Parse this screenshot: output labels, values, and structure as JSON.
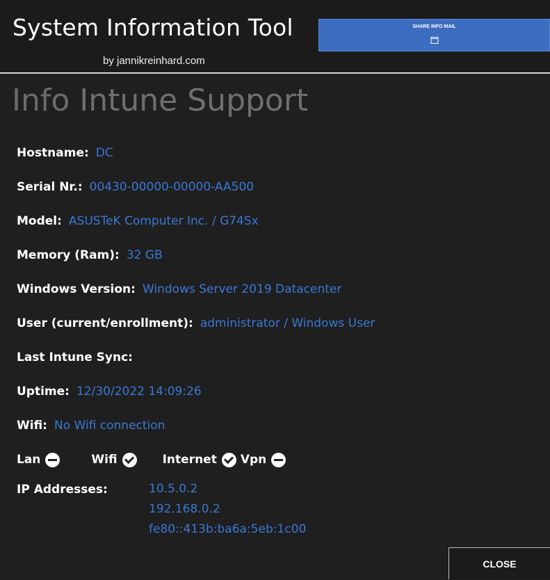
{
  "header": {
    "title": "System Information Tool",
    "byline": "by jannikreinhard.com",
    "button_label": "SHARE INFO MAIL"
  },
  "nav": {
    "tabs": [
      {
        "label": "Info"
      },
      {
        "label": "Intune"
      },
      {
        "label": "Support"
      }
    ]
  },
  "info": {
    "hostname": {
      "label": "Hostname:",
      "value": "DC"
    },
    "serial": {
      "label": "Serial Nr.:",
      "value": "00430-00000-00000-AA500"
    },
    "model": {
      "label": "Model:",
      "value": "ASUSTeK Computer Inc. / G74Sx"
    },
    "memory": {
      "label": "Memory (Ram):",
      "value": "32 GB"
    },
    "windows_version": {
      "label": "Windows Version:",
      "value": "Windows Server 2019 Datacenter"
    },
    "user": {
      "label": "User (current/enrollment):",
      "value": "administrator / Windows User"
    },
    "last_sync": {
      "label": "Last Intune Sync:",
      "value": ""
    },
    "uptime": {
      "label": "Uptime:",
      "value": "12/30/2022 14:09:26"
    },
    "wifi": {
      "label": "Wifi:",
      "value": "No Wifi connection"
    }
  },
  "status": {
    "lan": {
      "label": "Lan",
      "icon": "minus-circle-icon"
    },
    "wifi": {
      "label": "Wifi",
      "icon": "check-circle-icon"
    },
    "internet": {
      "label": "Internet",
      "icon": "check-circle-icon"
    },
    "vpn": {
      "label": "Vpn",
      "icon": "minus-circle-icon"
    }
  },
  "ip": {
    "label": "IP Addresses:",
    "addresses": [
      "10.5.0.2",
      "192.168.0.2",
      "fe80::413b:ba6a:5eb:1c00"
    ]
  },
  "footer": {
    "close_label": "CLOSE"
  },
  "colors": {
    "background": "#1f1f1f",
    "accent": "#3d6dc0",
    "value_text": "#3a78d4",
    "tab_text": "#6f6f6f"
  }
}
